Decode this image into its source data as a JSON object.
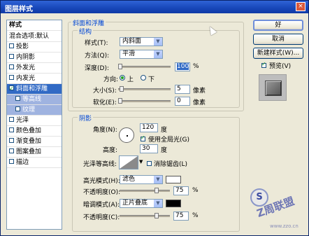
{
  "window": {
    "title": "图层样式",
    "close_glyph": "×"
  },
  "style_list": {
    "header": "样式",
    "items": [
      {
        "label": "混合选项:默认",
        "type": "plain"
      },
      {
        "label": "投影",
        "type": "check",
        "checked": false
      },
      {
        "label": "内阴影",
        "type": "check",
        "checked": false
      },
      {
        "label": "外发光",
        "type": "check",
        "checked": false
      },
      {
        "label": "内发光",
        "type": "check",
        "checked": false
      },
      {
        "label": "斜面和浮雕",
        "type": "check",
        "checked": true,
        "selected": true
      },
      {
        "label": "等高线",
        "type": "sub",
        "checked": false
      },
      {
        "label": "纹理",
        "type": "sub",
        "checked": false
      },
      {
        "label": "光泽",
        "type": "check",
        "checked": false
      },
      {
        "label": "颜色叠加",
        "type": "check",
        "checked": false
      },
      {
        "label": "渐变叠加",
        "type": "check",
        "checked": false
      },
      {
        "label": "图案叠加",
        "type": "check",
        "checked": false
      },
      {
        "label": "描边",
        "type": "check",
        "checked": false
      }
    ]
  },
  "bevel": {
    "group_title": "斜面和浮雕",
    "structure_title": "结构",
    "style_label": "样式(T):",
    "style_value": "内斜面",
    "technique_label": "方法(Q):",
    "technique_value": "平滑",
    "depth_label": "深度(D):",
    "depth_value": "100",
    "depth_unit": "%",
    "depth_percent": 100,
    "direction_label": "方向:",
    "dir_up": "上",
    "dir_down": "下",
    "size_label": "大小(S):",
    "size_value": "5",
    "size_unit": "像素",
    "soften_label": "软化(E):",
    "soften_value": "0",
    "soften_unit": "像素"
  },
  "shading": {
    "title": "阴影",
    "angle_label": "角度(N):",
    "angle_value": "120",
    "angle_unit": "度",
    "global_light_label": "使用全局光(G)",
    "global_light_checked": true,
    "altitude_label": "高度:",
    "altitude_value": "30",
    "altitude_unit": "度",
    "gloss_contour_label": "光泽等高线:",
    "antialias_label": "消除锯齿(L)",
    "highlight_mode_label": "高光模式(H):",
    "highlight_mode_value": "滤色",
    "highlight_color": "#ffffff",
    "opacity1_label": "不透明度(O):",
    "opacity1_value": "75",
    "opacity_unit": "%",
    "shadow_mode_label": "暗调模式(A):",
    "shadow_mode_value": "正片叠底",
    "shadow_color": "#000000",
    "opacity2_label": "不透明度(C):",
    "opacity2_value": "75"
  },
  "buttons": {
    "ok": "好",
    "cancel": "取消",
    "new_style": "新建样式(W)...",
    "preview_label": "预览(V)",
    "preview_checked": true
  },
  "watermark": {
    "line1": "S",
    "brand": "Z周联盟",
    "url": "www.zzo.cn"
  },
  "colors": {
    "titlebar": "#1746b8",
    "selection": "#316ac5",
    "group_title": "#0046d5"
  }
}
